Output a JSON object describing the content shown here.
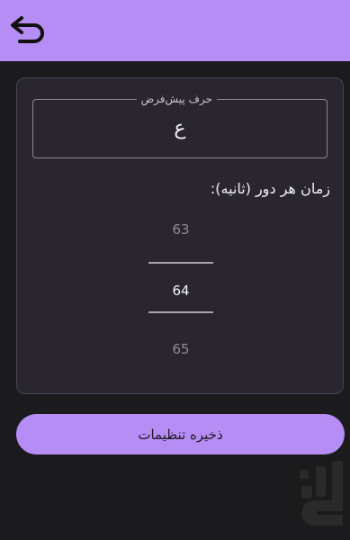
{
  "header": {
    "background_color": "#b68cf5",
    "back_icon": "back-arrow-icon"
  },
  "settings": {
    "default_letter_label": "حرف پیش‌فرض",
    "default_letter_value": "ع",
    "round_time_label": "زمان هر دور (ثانیه):",
    "picker": {
      "previous": "63",
      "current": "64",
      "next": "65"
    }
  },
  "actions": {
    "save_label": "ذخیره تنظیمات"
  },
  "watermark": {
    "icon": "store-logo-icon"
  }
}
